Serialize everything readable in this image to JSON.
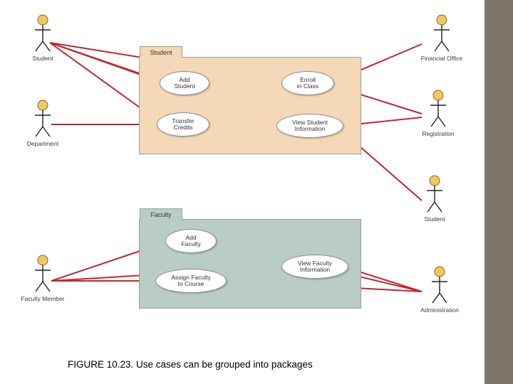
{
  "figure": {
    "caption": "FIGURE 10.23. Use cases can be grouped into packages"
  },
  "colors": {
    "pkg_student_fill": "#f4d8b7",
    "pkg_faculty_fill": "#b9ccc6",
    "sidebar": "#7d766a",
    "connection": "#c1272d",
    "actor_head": "#f0c95e"
  },
  "actors": {
    "left_student": {
      "label": "Student"
    },
    "department": {
      "label": "Department"
    },
    "faculty_member": {
      "label": "Faculty Member"
    },
    "financial_office": {
      "label": "Financial Office"
    },
    "registration": {
      "label": "Registration"
    },
    "right_student": {
      "label": "Student"
    },
    "administration": {
      "label": "Administration"
    }
  },
  "packages": {
    "student": {
      "label": "Student"
    },
    "faculty": {
      "label": "Faculty"
    }
  },
  "usecases": {
    "add_student": {
      "label": "Add\nStudent"
    },
    "enroll_in_class": {
      "label": "Enroll\nin Class"
    },
    "transfer_credits": {
      "label": "Transfer\nCredits"
    },
    "view_student_info": {
      "label": "View Student\nInformation"
    },
    "add_faculty": {
      "label": "Add\nFaculty"
    },
    "assign_faculty": {
      "label": "Assign Faculty\nto Course"
    },
    "view_faculty_info": {
      "label": "View Faculty\nInformation"
    }
  }
}
